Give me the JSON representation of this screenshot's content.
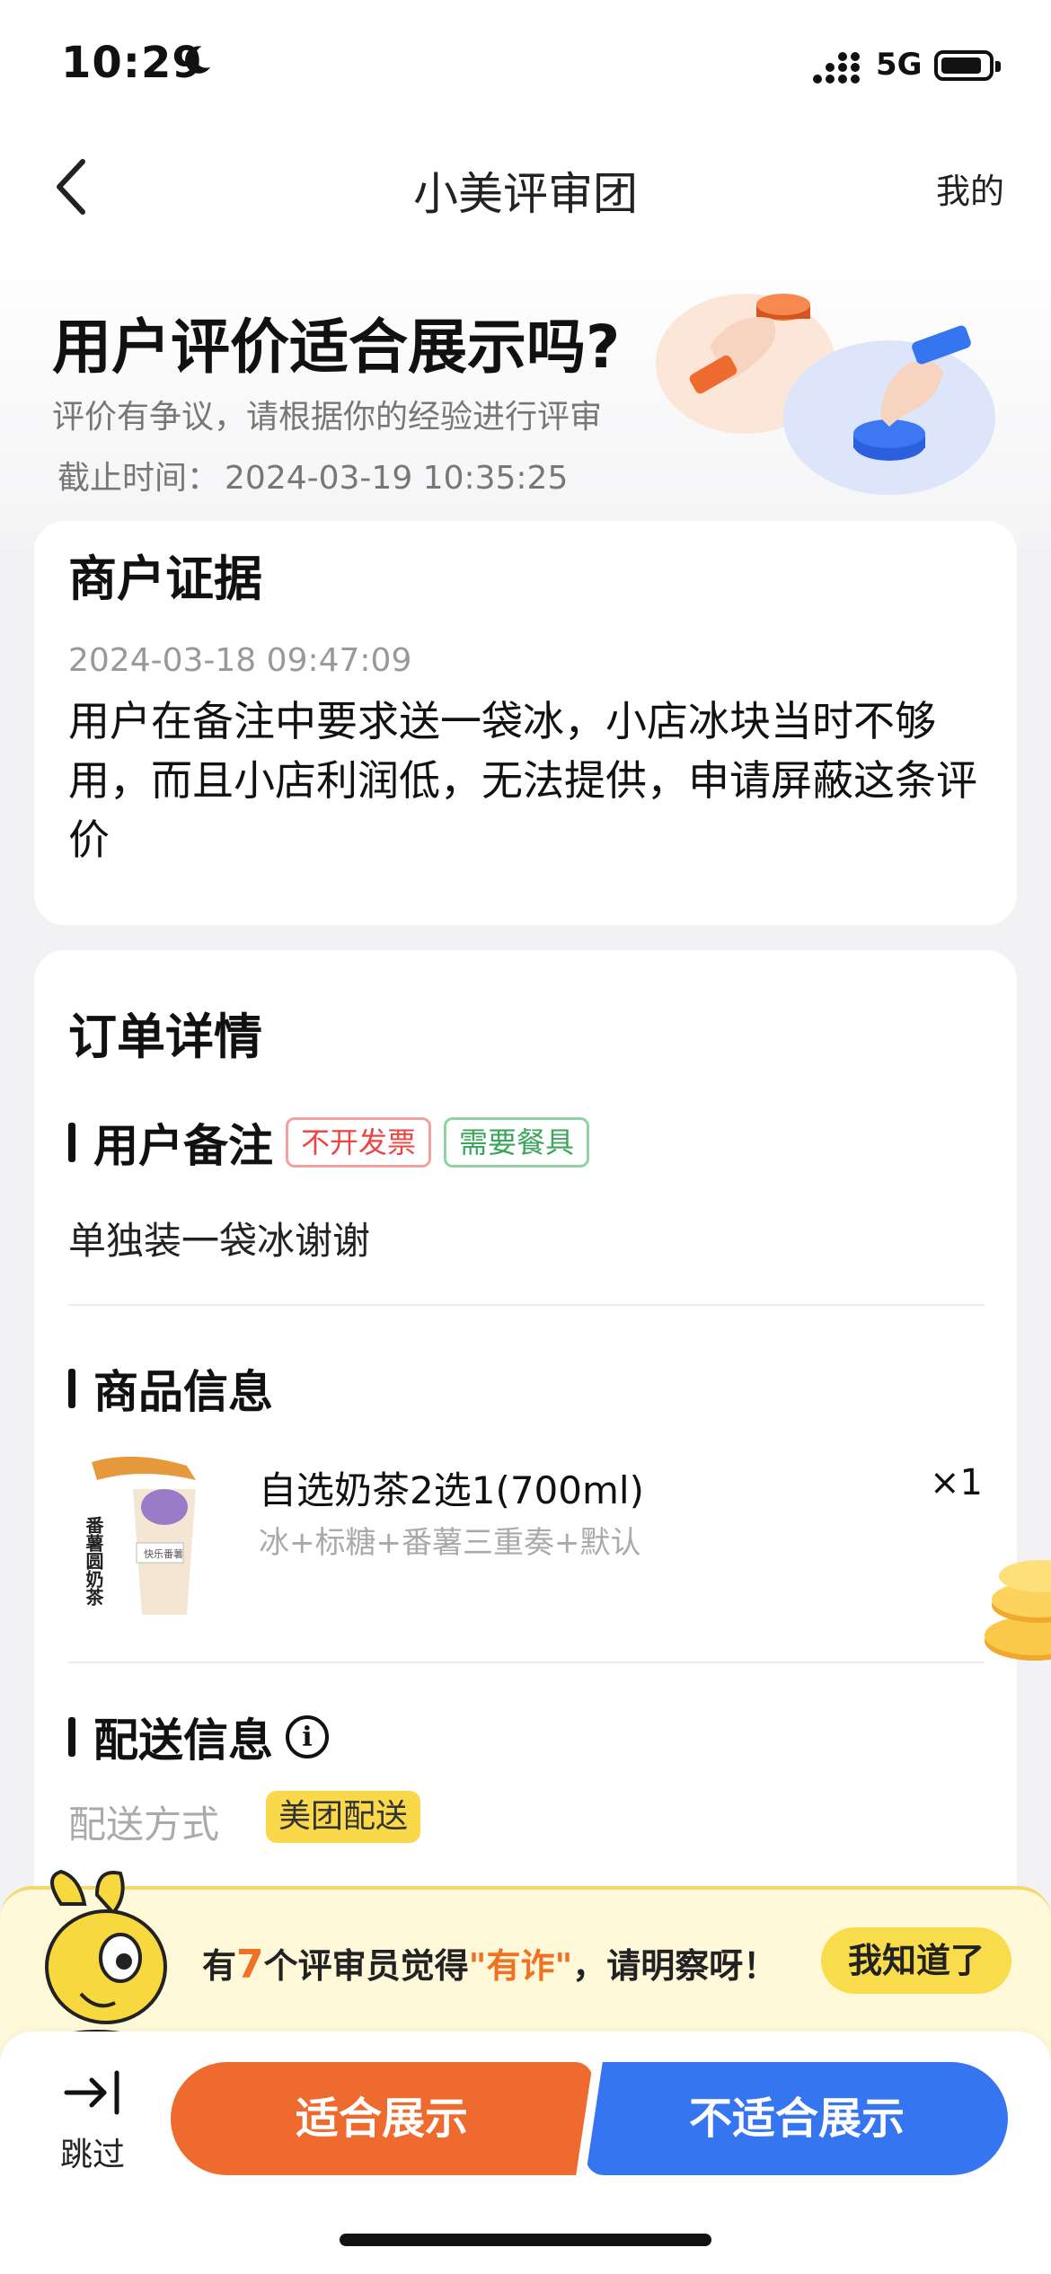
{
  "status_bar": {
    "time": "10:29",
    "network": "5G"
  },
  "nav": {
    "title": "小美评审团",
    "right_link": "我的"
  },
  "header": {
    "title": "用户评价适合展示吗?",
    "subtitle": "评价有争议，请根据你的经验进行评审",
    "deadline_label": "截止时间：",
    "deadline_value": "2024-03-19 10:35:25"
  },
  "merchant_evidence": {
    "heading": "商户证据",
    "date": "2024-03-18 09:47:09",
    "text": "用户在备注中要求送一袋冰，小店冰块当时不够用，而且小店利润低，无法提供，申请屏蔽这条评价"
  },
  "order_details": {
    "heading": "订单详情",
    "user_note": {
      "label": "用户备注",
      "tags": [
        "不开发票",
        "需要餐具"
      ],
      "text": "单独装一袋冰谢谢"
    },
    "product_info": {
      "label": "商品信息",
      "name": "自选奶茶2选1(700ml)",
      "options": "冰+标糖+番薯三重奏+默认",
      "quantity": "×1",
      "image_text": "番薯圆奶茶"
    },
    "delivery_info": {
      "label": "配送信息",
      "info_icon_glyph": "i",
      "method_label": "配送方式",
      "method_value": "美团配送"
    }
  },
  "notice": {
    "prefix": "有",
    "count": "7",
    "middle": "个评审员觉得",
    "quote": "\"有诈\"",
    "suffix": "，请明察呀！",
    "button": "我知道了"
  },
  "actions": {
    "skip_label": "跳过",
    "suitable": "适合展示",
    "not_suitable": "不适合展示"
  },
  "colors": {
    "orange": "#ef6a2e",
    "blue": "#3575ef",
    "yellow": "#f9dc4c",
    "tag_red": "#ee4444",
    "tag_green": "#3aa65a"
  }
}
